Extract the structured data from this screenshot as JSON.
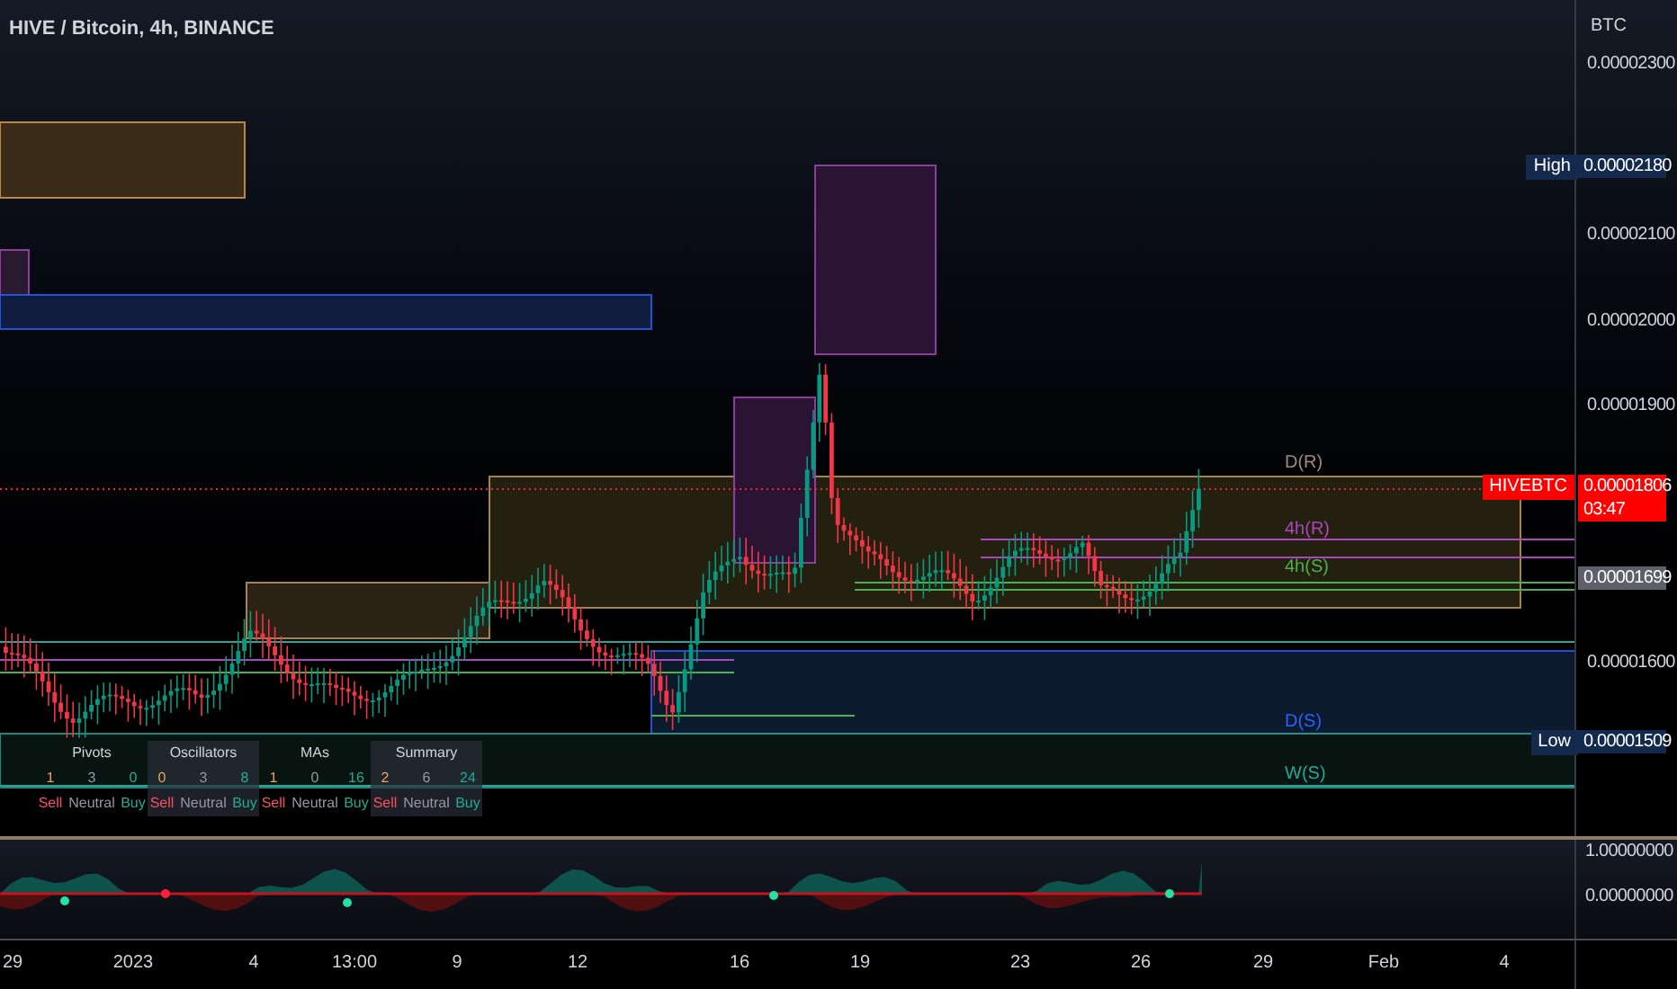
{
  "symbol_title": "HIVE / Bitcoin, 4h, BINANCE",
  "price_axis": {
    "unit": "BTC",
    "ticks": [
      "0.00002300",
      "0.00002100",
      "0.00002000",
      "0.00001900",
      "0.00001600"
    ]
  },
  "markers": [
    {
      "kind": "high",
      "label": "High",
      "value": "0.00002180"
    },
    {
      "kind": "last",
      "label": "HIVEBTC",
      "value": "0.00001806",
      "countdown": "03:47"
    },
    {
      "kind": "level",
      "value": "0.00001699"
    },
    {
      "kind": "low",
      "label": "Low",
      "value": "0.00001509"
    }
  ],
  "zone_labels": [
    {
      "text": "D(R)",
      "color": "#a1887f"
    },
    {
      "text": "4h(R)",
      "color": "#ab47bc"
    },
    {
      "text": "4h(S)",
      "color": "#4caf50"
    },
    {
      "text": "D(S)",
      "color": "#2962ff"
    },
    {
      "text": "W(S)",
      "color": "#26a69a"
    }
  ],
  "summary_table": [
    {
      "title": "Pivots",
      "shaded": false,
      "cells": [
        {
          "count": "1",
          "kind": "sell",
          "label": "Sell"
        },
        {
          "count": "3",
          "kind": "neutral",
          "label": "Neutral"
        },
        {
          "count": "0",
          "kind": "buy",
          "label": "Buy"
        }
      ]
    },
    {
      "title": "Oscillators",
      "shaded": true,
      "cells": [
        {
          "count": "0",
          "kind": "sell",
          "label": "Sell"
        },
        {
          "count": "3",
          "kind": "neutral",
          "label": "Neutral"
        },
        {
          "count": "8",
          "kind": "buy",
          "label": "Buy"
        }
      ]
    },
    {
      "title": "MAs",
      "shaded": false,
      "cells": [
        {
          "count": "1",
          "kind": "sell",
          "label": "Sell"
        },
        {
          "count": "0",
          "kind": "neutral",
          "label": "Neutral"
        },
        {
          "count": "16",
          "kind": "buy",
          "label": "Buy"
        }
      ]
    },
    {
      "title": "Summary",
      "shaded": true,
      "cells": [
        {
          "count": "2",
          "kind": "sell",
          "label": "Sell"
        },
        {
          "count": "6",
          "kind": "neutral",
          "label": "Neutral"
        },
        {
          "count": "24",
          "kind": "buy",
          "label": "Buy"
        }
      ]
    }
  ],
  "oscillator_axis": [
    "1.00000000",
    "0.00000000"
  ],
  "time_axis": [
    "29",
    "2023",
    "4",
    "13:00",
    "9",
    "12",
    "16",
    "19",
    "23",
    "26",
    "29",
    "Feb",
    "4"
  ]
}
